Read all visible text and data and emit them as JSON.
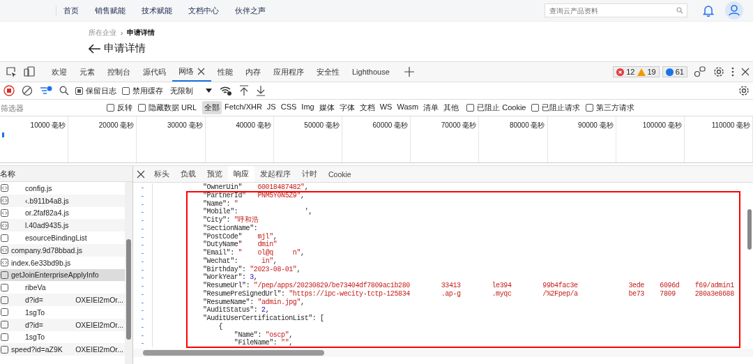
{
  "site_nav": {
    "items": [
      "首页",
      "销售赋能",
      "技术赋能",
      "文档中心",
      "伙伴之声"
    ],
    "search": {
      "placeholder": "查询云产品资料"
    }
  },
  "breadcrumb": {
    "items": [
      "所在企业",
      "申请详情"
    ],
    "separator": "›"
  },
  "page_title": "申请详情",
  "devtools": {
    "tabs": [
      {
        "label": "欢迎",
        "selected": false
      },
      {
        "label": "元素",
        "selected": false
      },
      {
        "label": "控制台",
        "selected": false
      },
      {
        "label": "源代码",
        "selected": false
      },
      {
        "label": "网络",
        "selected": true
      },
      {
        "label": "性能",
        "selected": false
      },
      {
        "label": "内存",
        "selected": false
      },
      {
        "label": "应用程序",
        "selected": false
      },
      {
        "label": "安全性",
        "selected": false
      },
      {
        "label": "Lighthouse",
        "selected": false
      }
    ],
    "counts": {
      "errors": "12",
      "warnings": "19",
      "messages": "61"
    },
    "toolbar": {
      "preserve_log": {
        "label": "保留日志",
        "checked": true
      },
      "disable_cache": {
        "label": "禁用缓存",
        "checked": false
      },
      "throttle": "无限制"
    },
    "filter": {
      "placeholder": "筛选器",
      "checks": [
        {
          "label": "反转",
          "checked": false
        },
        {
          "label": "隐藏数据 URL",
          "checked": false
        }
      ],
      "types": [
        {
          "label": "全部",
          "selected": true
        },
        {
          "label": "Fetch/XHR",
          "selected": false
        },
        {
          "label": "JS",
          "selected": false
        },
        {
          "label": "CSS",
          "selected": false
        },
        {
          "label": "Img",
          "selected": false
        },
        {
          "label": "媒体",
          "selected": false
        },
        {
          "label": "字体",
          "selected": false
        },
        {
          "label": "文档",
          "selected": false
        },
        {
          "label": "WS",
          "selected": false
        },
        {
          "label": "Wasm",
          "selected": false
        },
        {
          "label": "清单",
          "selected": false
        },
        {
          "label": "其他",
          "selected": false
        }
      ],
      "more_checks": [
        {
          "label": "已阻止 Cookie",
          "checked": false
        },
        {
          "label": "已阻止请求",
          "checked": false
        },
        {
          "label": "第三方请求",
          "checked": false
        }
      ]
    },
    "timeline": [
      "10000 毫秒",
      "20000 毫秒",
      "30000 毫秒",
      "40000 毫秒",
      "50000 毫秒",
      "60000 毫秒",
      "70000 毫秒",
      "80000 毫秒",
      "90000 毫秒",
      "100000 毫秒",
      "110000 毫秒"
    ],
    "requests": {
      "header": "名称",
      "rows": [
        {
          "kind": "script",
          "name": "config.js",
          "selected": false
        },
        {
          "kind": "script",
          "name": "‹.b911b4a8.js",
          "selected": false
        },
        {
          "kind": "script",
          "name": "or.2faf82a4.js",
          "selected": false
        },
        {
          "kind": "script",
          "name": "l.40ad9435.js",
          "selected": false
        },
        {
          "kind": "document",
          "name": "esourceBindingList",
          "selected": false
        },
        {
          "kind": "script",
          "name": "company.9d78bbad.js",
          "selected": false
        },
        {
          "kind": "script",
          "name": "index.6e33bd9b.js",
          "selected": false
        },
        {
          "kind": "document",
          "name": "getJoinEnterpriseApplyInfo",
          "selected": true
        },
        {
          "kind": "document",
          "name": "ribeVa",
          "selected": false
        },
        {
          "kind": "document",
          "name": "d?id=",
          "tail": "OXEIEl2mOr...",
          "selected": false
        },
        {
          "kind": "document",
          "name": "1sgTo",
          "selected": false
        },
        {
          "kind": "document",
          "name": "d?id=",
          "tail": "OXEIEl2mOr...",
          "selected": false
        },
        {
          "kind": "document",
          "name": "1sgTo",
          "selected": false
        },
        {
          "kind": "document",
          "name": "speed?id=aZ9K",
          "tail": "OXEIEl2mOr...",
          "selected": false
        }
      ]
    },
    "detail_tabs": [
      {
        "label": "标头",
        "selected": false
      },
      {
        "label": "负载",
        "selected": false
      },
      {
        "label": "预览",
        "selected": false
      },
      {
        "label": "响应",
        "selected": true
      },
      {
        "label": "发起程序",
        "selected": false
      },
      {
        "label": "计时",
        "selected": false
      },
      {
        "label": "Cookie",
        "selected": false
      }
    ],
    "response_lines": [
      {
        "marker": "-",
        "parts": [
          {
            "kind": "key",
            "text": "\"OwnerUin\""
          },
          {
            "kind": "string",
            "text": "    60018487482\""
          },
          {
            "kind": "punct",
            "text": ","
          }
        ]
      },
      {
        "marker": "-",
        "parts": [
          {
            "kind": "key",
            "text": "\"PartnerId\""
          },
          {
            "kind": "string",
            "text": "   PNM5Y0N5Z9\""
          },
          {
            "kind": "punct",
            "text": ","
          }
        ]
      },
      {
        "marker": "-",
        "parts": [
          {
            "kind": "key",
            "text": "\"Name\""
          },
          {
            "kind": "punct",
            "text": ": "
          },
          {
            "kind": "string",
            "text": "\""
          }
        ]
      },
      {
        "marker": "-",
        "parts": [
          {
            "kind": "key",
            "text": "\"Mobile\""
          },
          {
            "kind": "punct",
            "text": ":                 ',"
          }
        ]
      },
      {
        "marker": "-",
        "parts": [
          {
            "kind": "key",
            "text": "\"City\""
          },
          {
            "kind": "punct",
            "text": ": "
          },
          {
            "kind": "string",
            "text": "\"呼和浩"
          }
        ]
      },
      {
        "marker": "-",
        "parts": [
          {
            "kind": "key",
            "text": "\"SectionName\""
          },
          {
            "kind": "punct",
            "text": ":"
          }
        ]
      },
      {
        "marker": "-",
        "parts": [
          {
            "kind": "key",
            "text": "\"PostCode\""
          },
          {
            "kind": "string",
            "text": "    mjl\""
          },
          {
            "kind": "punct",
            "text": ","
          }
        ]
      },
      {
        "marker": "-",
        "parts": [
          {
            "kind": "key",
            "text": "\"DutyName\""
          },
          {
            "kind": "string",
            "text": "    dmin\""
          }
        ]
      },
      {
        "marker": "-",
        "parts": [
          {
            "kind": "key",
            "text": "\"Email\""
          },
          {
            "kind": "punct",
            "text": ": "
          },
          {
            "kind": "string",
            "text": "\"    ol@q     n\""
          },
          {
            "kind": "punct",
            "text": ","
          }
        ]
      },
      {
        "marker": "-",
        "parts": [
          {
            "kind": "key",
            "text": "\"Wechat\""
          },
          {
            "kind": "punct",
            "text": ":"
          },
          {
            "kind": "string",
            "text": "      in\""
          },
          {
            "kind": "punct",
            "text": ","
          }
        ]
      },
      {
        "marker": "-",
        "parts": [
          {
            "kind": "key",
            "text": "\"Birthday\""
          },
          {
            "kind": "punct",
            "text": ": "
          },
          {
            "kind": "string",
            "text": "\"2023-08-01\""
          },
          {
            "kind": "punct",
            "text": ","
          }
        ]
      },
      {
        "marker": "-",
        "parts": [
          {
            "kind": "key",
            "text": "\"WorkYear\""
          },
          {
            "kind": "punct",
            "text": ": "
          },
          {
            "kind": "number",
            "text": "3"
          },
          {
            "kind": "punct",
            "text": ","
          }
        ]
      },
      {
        "marker": "-",
        "parts": [
          {
            "kind": "key",
            "text": "\"ResumeUrl\""
          },
          {
            "kind": "punct",
            "text": ": "
          },
          {
            "kind": "string",
            "text": "\"/pep/apps/20230829/be73404df7809ac1b280        33413        le394        99b4fac3e             3ede    6096d    f69/admin1"
          }
        ]
      },
      {
        "marker": "-",
        "parts": [
          {
            "kind": "key",
            "text": "\"ResumePreSignedUrl\""
          },
          {
            "kind": "punct",
            "text": ": "
          },
          {
            "kind": "string",
            "text": "\"https://ipc-wecity-tctp-125834        .ap-g        .myqc        /%2Fpep/a             be73    7809     280a3e8688"
          }
        ]
      },
      {
        "marker": "-",
        "parts": [
          {
            "kind": "key",
            "text": "\"ResumeName\""
          },
          {
            "kind": "punct",
            "text": ": "
          },
          {
            "kind": "string",
            "text": "\"admin.jpg\""
          },
          {
            "kind": "punct",
            "text": ","
          }
        ]
      },
      {
        "marker": "-",
        "parts": [
          {
            "kind": "key",
            "text": "\"AuditStatus\""
          },
          {
            "kind": "punct",
            "text": ": "
          },
          {
            "kind": "number",
            "text": "2"
          },
          {
            "kind": "punct",
            "text": ","
          }
        ]
      },
      {
        "marker": "-",
        "parts": [
          {
            "kind": "key",
            "text": "\"AuditUserCertificationList\""
          },
          {
            "kind": "punct",
            "text": ": ["
          }
        ]
      },
      {
        "marker": "-",
        "parts": [
          {
            "kind": "punct",
            "text": "    {"
          }
        ]
      },
      {
        "marker": "-",
        "parts": [
          {
            "kind": "key",
            "text": "        \"Name\""
          },
          {
            "kind": "punct",
            "text": ": "
          },
          {
            "kind": "string",
            "text": "\"oscp\""
          },
          {
            "kind": "punct",
            "text": ","
          }
        ]
      },
      {
        "marker": "-",
        "parts": [
          {
            "kind": "key",
            "text": "        \"FileName\""
          },
          {
            "kind": "punct",
            "text": ": "
          },
          {
            "kind": "string",
            "text": "\"\""
          },
          {
            "kind": "punct",
            "text": ","
          }
        ]
      }
    ]
  }
}
